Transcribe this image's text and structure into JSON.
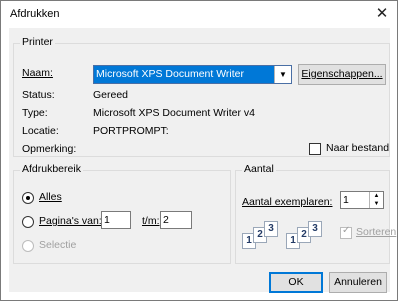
{
  "window": {
    "title": "Afdrukken",
    "close_glyph": "✕"
  },
  "printer": {
    "group_title": "Printer",
    "name_label": "Naam:",
    "name_value": "Microsoft XPS Document Writer",
    "properties_button": "Eigenschappen...",
    "status_label": "Status:",
    "status_value": "Gereed",
    "type_label": "Type:",
    "type_value": "Microsoft XPS Document Writer v4",
    "location_label": "Locatie:",
    "location_value": "PORTPROMPT:",
    "comment_label": "Opmerking:",
    "to_file_label": "Naar bestand"
  },
  "range": {
    "group_title": "Afdrukbereik",
    "all_label": "Alles",
    "pages_label": "Pagina's van:",
    "from_value": "1",
    "to_label": "t/m:",
    "to_value": "2",
    "selection_label": "Selectie"
  },
  "copies": {
    "group_title": "Aantal",
    "copies_label": "Aantal exemplaren:",
    "copies_value": "1",
    "collate_label": "Sorteren",
    "page_numbers": [
      "1",
      "2",
      "3"
    ]
  },
  "buttons": {
    "ok": "OK",
    "cancel": "Annuleren"
  },
  "icons": {
    "combo": "chevron-down-icon",
    "spin_up": "spin-up-icon",
    "spin_down": "spin-down-icon"
  }
}
